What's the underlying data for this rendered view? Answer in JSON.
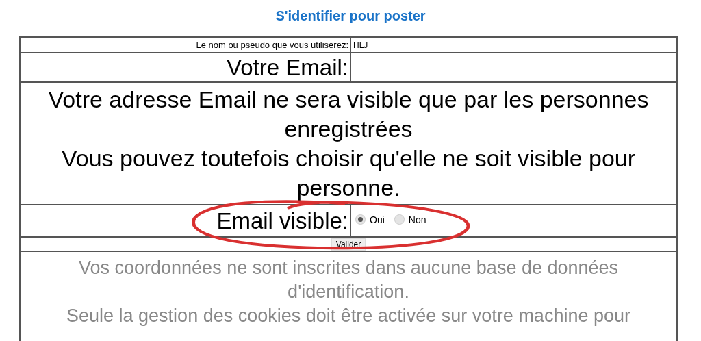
{
  "title": "S'identifier pour poster",
  "form": {
    "name_label": "Le nom ou pseudo que vous utiliserez:",
    "name_value": "HLJ",
    "email_label": "Votre Email:",
    "email_notice": [
      "Votre adresse Email ne sera visible que par les personnes enregistrées",
      "Vous pouvez toutefois choisir qu'elle ne soit visible pour personne."
    ],
    "visibility_label": "Email visible:",
    "visibility_options": [
      {
        "label": "Oui",
        "selected": true
      },
      {
        "label": "Non",
        "selected": false
      }
    ],
    "submit": "Valider",
    "footer_notice": [
      "Vos coordonnées ne sont inscrites dans aucune base de données d'identification.",
      "Seule la gestion des cookies doit être activée sur votre machine pour"
    ]
  }
}
